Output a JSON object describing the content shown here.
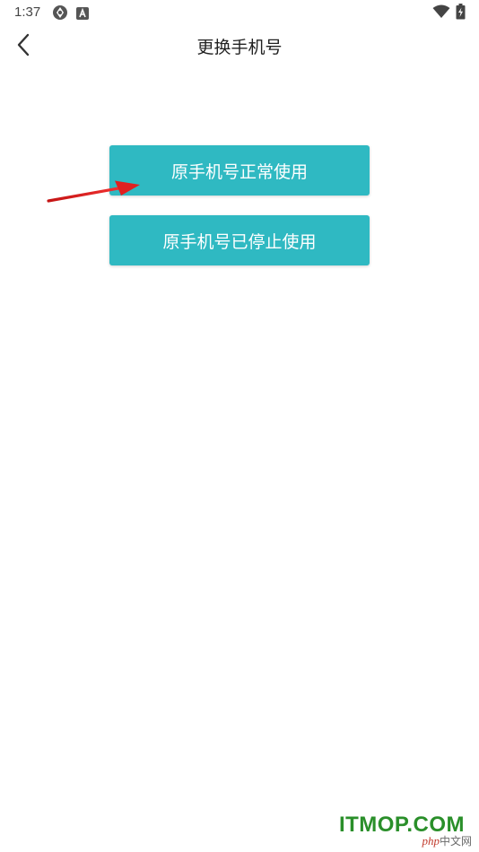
{
  "status_bar": {
    "time": "1:37",
    "icons": [
      "sync-icon",
      "app-notification-icon",
      "wifi-icon",
      "battery-charging-icon"
    ]
  },
  "app_bar": {
    "back_icon": "chevron-left-icon",
    "title": "更换手机号"
  },
  "options": [
    {
      "label": "原手机号正常使用"
    },
    {
      "label": "原手机号已停止使用"
    }
  ],
  "annotation": {
    "arrow_color": "#e02020",
    "points_to": "option-normal-use"
  },
  "theme": {
    "accent": "#2fb9c2",
    "background": "#ffffff"
  },
  "watermark": {
    "main": "ITMOP.COM",
    "php": "php",
    "sub": "中文网"
  }
}
